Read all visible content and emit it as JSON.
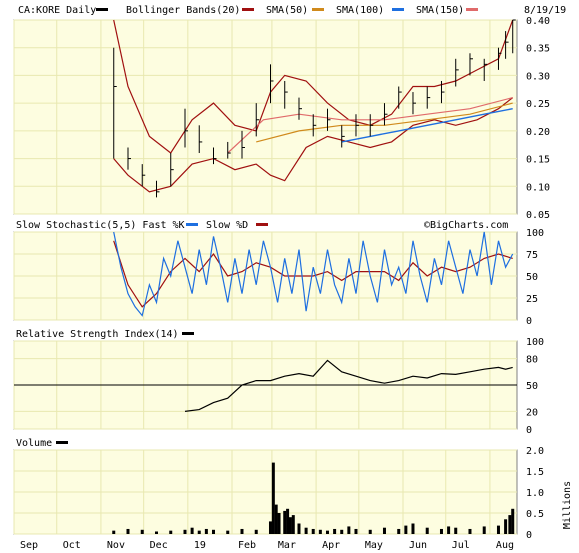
{
  "header": {
    "symbol": "CA:KORE Daily",
    "date": "8/19/19",
    "watermark": "©BigCharts.com"
  },
  "legend": {
    "main": [
      {
        "label": "Bollinger Bands(20)",
        "color": "#000000"
      },
      {
        "label": "SMA(50)",
        "color": "#a01010"
      },
      {
        "label": "SMA(100)",
        "color": "#d08a1c"
      },
      {
        "label": "SMA(150)",
        "color": "#1e6fe0"
      },
      {
        "label": "",
        "color": "#e06a6a"
      }
    ],
    "stoch": [
      {
        "label": "Slow Stochastic(5,5) Fast %K",
        "color": "#1e6fe0"
      },
      {
        "label": "Slow %D",
        "color": "#a01010"
      }
    ],
    "rsi": [
      {
        "label": "Relative Strength Index(14)",
        "color": "#000000"
      }
    ],
    "volume": [
      {
        "label": "Volume",
        "color": "#000000"
      }
    ]
  },
  "colors": {
    "panel_bg": "#fdfde0",
    "grid": "#e8e8b0",
    "price_bars": "#000000",
    "bollinger": "#a01010",
    "sma50": "#e06a6a",
    "sma100": "#d08a1c",
    "sma150": "#1e6fe0",
    "stoch_k": "#1e6fe0",
    "stoch_d": "#a01010"
  },
  "chart_data": [
    {
      "type": "line",
      "title": "CA:KORE Daily",
      "yaxis_ticks": [
        "0.40",
        "0.35",
        "0.30",
        "0.25",
        "0.20",
        "0.15",
        "0.10",
        "0.05"
      ],
      "ylim": [
        0.05,
        0.4
      ],
      "x_months": [
        "Sep",
        "Oct",
        "Nov",
        "Dec",
        "19",
        "Feb",
        "Mar",
        "Apr",
        "May",
        "Jun",
        "Jul",
        "Aug"
      ],
      "x_month_days": [
        0,
        30,
        61,
        91,
        122,
        153,
        181,
        212,
        242,
        273,
        303,
        334
      ],
      "x_range": [
        0,
        353
      ],
      "note": "Daily high-low bars with Bollinger band envelope and moving averages",
      "price": {
        "days": [
          70,
          80,
          90,
          100,
          110,
          120,
          130,
          140,
          150,
          160,
          170,
          180,
          190,
          200,
          210,
          220,
          230,
          240,
          250,
          260,
          270,
          280,
          290,
          300,
          310,
          320,
          330,
          340,
          345,
          350
        ],
        "close": [
          0.28,
          0.15,
          0.12,
          0.09,
          0.13,
          0.2,
          0.18,
          0.15,
          0.16,
          0.17,
          0.22,
          0.29,
          0.27,
          0.24,
          0.21,
          0.22,
          0.19,
          0.21,
          0.21,
          0.23,
          0.27,
          0.25,
          0.26,
          0.27,
          0.31,
          0.33,
          0.32,
          0.34,
          0.36,
          0.4
        ],
        "high": [
          0.35,
          0.17,
          0.14,
          0.11,
          0.16,
          0.24,
          0.21,
          0.17,
          0.18,
          0.2,
          0.25,
          0.32,
          0.29,
          0.26,
          0.23,
          0.24,
          0.21,
          0.23,
          0.23,
          0.25,
          0.28,
          0.27,
          0.28,
          0.29,
          0.33,
          0.34,
          0.33,
          0.35,
          0.38,
          0.4
        ],
        "low": [
          0.15,
          0.13,
          0.1,
          0.08,
          0.1,
          0.17,
          0.16,
          0.14,
          0.15,
          0.15,
          0.19,
          0.25,
          0.24,
          0.22,
          0.19,
          0.2,
          0.17,
          0.19,
          0.19,
          0.21,
          0.24,
          0.23,
          0.24,
          0.25,
          0.28,
          0.3,
          0.29,
          0.31,
          0.33,
          0.34
        ]
      },
      "bollinger_upper": {
        "days": [
          70,
          80,
          95,
          110,
          125,
          140,
          155,
          170,
          180,
          190,
          205,
          220,
          235,
          250,
          265,
          280,
          295,
          310,
          325,
          340,
          350
        ],
        "values": [
          0.4,
          0.28,
          0.19,
          0.16,
          0.22,
          0.25,
          0.21,
          0.2,
          0.27,
          0.3,
          0.29,
          0.25,
          0.22,
          0.21,
          0.23,
          0.28,
          0.28,
          0.29,
          0.31,
          0.33,
          0.4
        ]
      },
      "bollinger_lower": {
        "days": [
          70,
          80,
          95,
          110,
          125,
          140,
          155,
          170,
          180,
          190,
          205,
          220,
          235,
          250,
          265,
          280,
          295,
          310,
          325,
          340,
          350
        ],
        "values": [
          0.15,
          0.12,
          0.09,
          0.1,
          0.14,
          0.15,
          0.13,
          0.14,
          0.12,
          0.11,
          0.17,
          0.19,
          0.18,
          0.17,
          0.18,
          0.21,
          0.22,
          0.21,
          0.22,
          0.24,
          0.26
        ]
      },
      "sma50": {
        "days": [
          150,
          175,
          200,
          230,
          260,
          290,
          320,
          350
        ],
        "values": [
          0.16,
          0.22,
          0.23,
          0.22,
          0.22,
          0.23,
          0.24,
          0.26
        ]
      },
      "sma100": {
        "days": [
          170,
          200,
          230,
          260,
          290,
          320,
          350
        ],
        "values": [
          0.18,
          0.2,
          0.21,
          0.21,
          0.22,
          0.23,
          0.25
        ]
      },
      "sma150": {
        "days": [
          230,
          250,
          270,
          290,
          310,
          330,
          350
        ],
        "values": [
          0.18,
          0.19,
          0.2,
          0.21,
          0.22,
          0.23,
          0.24
        ]
      }
    },
    {
      "type": "line",
      "title": "Slow Stochastic(5,5) Fast %K / Slow %D",
      "yaxis_ticks": [
        "100",
        "75",
        "50",
        "25",
        "0"
      ],
      "ylim": [
        0,
        100
      ],
      "k": {
        "days": [
          70,
          75,
          80,
          85,
          90,
          95,
          100,
          105,
          110,
          115,
          120,
          125,
          130,
          135,
          140,
          145,
          150,
          155,
          160,
          165,
          170,
          175,
          180,
          185,
          190,
          195,
          200,
          205,
          210,
          215,
          220,
          225,
          230,
          235,
          240,
          245,
          250,
          255,
          260,
          265,
          270,
          275,
          280,
          285,
          290,
          295,
          300,
          305,
          310,
          315,
          320,
          325,
          330,
          335,
          340,
          345,
          350
        ],
        "values": [
          100,
          60,
          30,
          15,
          5,
          40,
          20,
          70,
          50,
          90,
          60,
          30,
          80,
          40,
          95,
          60,
          20,
          70,
          30,
          80,
          40,
          90,
          60,
          20,
          70,
          30,
          80,
          10,
          60,
          30,
          80,
          40,
          20,
          70,
          30,
          90,
          50,
          20,
          80,
          40,
          60,
          30,
          90,
          50,
          20,
          70,
          40,
          90,
          60,
          30,
          80,
          50,
          100,
          40,
          90,
          60,
          75
        ]
      },
      "d": {
        "days": [
          70,
          80,
          90,
          100,
          110,
          120,
          130,
          140,
          150,
          160,
          170,
          180,
          190,
          200,
          210,
          220,
          230,
          240,
          250,
          260,
          270,
          280,
          290,
          300,
          310,
          320,
          330,
          340,
          350
        ],
        "values": [
          90,
          40,
          15,
          30,
          55,
          70,
          55,
          75,
          50,
          55,
          65,
          60,
          50,
          50,
          50,
          55,
          45,
          55,
          55,
          55,
          45,
          65,
          50,
          60,
          55,
          60,
          70,
          75,
          70
        ]
      }
    },
    {
      "type": "line",
      "title": "Relative Strength Index(14)",
      "yaxis_ticks": [
        "100",
        "80",
        "50",
        "20",
        "0"
      ],
      "ylim": [
        0,
        100
      ],
      "reference_line": 50,
      "values": {
        "days": [
          120,
          130,
          140,
          150,
          160,
          170,
          180,
          190,
          200,
          210,
          220,
          230,
          240,
          250,
          260,
          270,
          280,
          290,
          300,
          310,
          320,
          330,
          340,
          345,
          350
        ],
        "values": [
          20,
          22,
          30,
          35,
          50,
          55,
          55,
          60,
          63,
          60,
          78,
          65,
          60,
          55,
          52,
          55,
          60,
          58,
          63,
          62,
          65,
          68,
          70,
          68,
          70
        ]
      }
    },
    {
      "type": "bar",
      "title": "Volume",
      "yaxis_ticks": [
        "2.0",
        "1.5",
        "1.0",
        "0.5",
        "0"
      ],
      "ylabel": "Millions",
      "ylim": [
        0,
        2.0
      ],
      "days": [
        70,
        80,
        90,
        100,
        110,
        120,
        125,
        130,
        135,
        140,
        150,
        160,
        170,
        180,
        182,
        184,
        186,
        190,
        192,
        194,
        196,
        200,
        205,
        210,
        215,
        220,
        225,
        230,
        235,
        240,
        250,
        260,
        270,
        275,
        280,
        290,
        300,
        305,
        310,
        320,
        330,
        340,
        345,
        348,
        350
      ],
      "values": [
        0.08,
        0.12,
        0.1,
        0.06,
        0.08,
        0.1,
        0.15,
        0.08,
        0.12,
        0.1,
        0.08,
        0.12,
        0.1,
        0.3,
        1.7,
        0.7,
        0.5,
        0.55,
        0.6,
        0.4,
        0.45,
        0.25,
        0.15,
        0.12,
        0.1,
        0.08,
        0.12,
        0.1,
        0.18,
        0.12,
        0.1,
        0.15,
        0.12,
        0.2,
        0.25,
        0.15,
        0.12,
        0.18,
        0.15,
        0.12,
        0.18,
        0.2,
        0.35,
        0.45,
        0.6
      ]
    }
  ],
  "x_axis_labels": [
    "Sep",
    "Oct",
    "Nov",
    "Dec",
    "19",
    "Feb",
    "Mar",
    "Apr",
    "May",
    "Jun",
    "Jul",
    "Aug"
  ]
}
